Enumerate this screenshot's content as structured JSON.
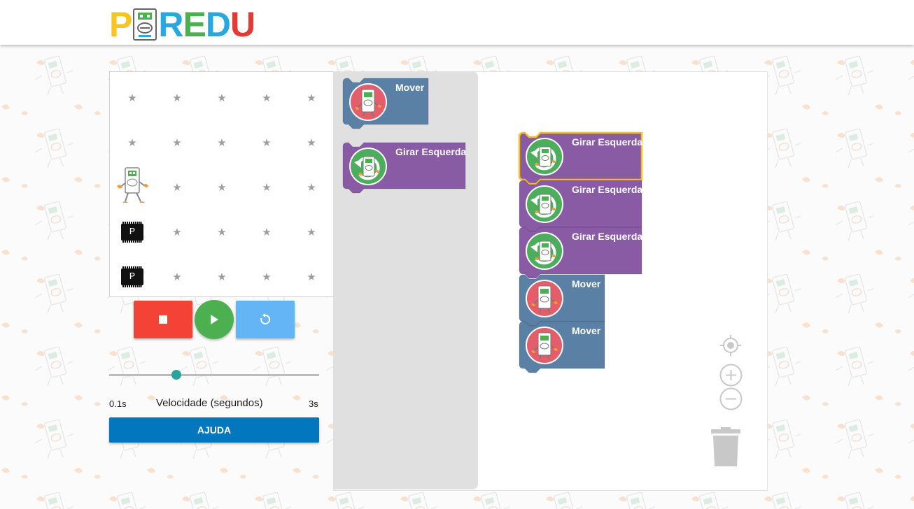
{
  "app": {
    "logo_letters": [
      {
        "char": "P",
        "color": "#f7c51e"
      },
      {
        "char": "R",
        "color": "#4caf50"
      },
      {
        "char": "E",
        "color": "#e53935"
      },
      {
        "char": "D",
        "color": "#29a8e0"
      },
      {
        "char": "U",
        "color": "#e53935"
      }
    ],
    "logo_robot_icon": "robot-face-icon"
  },
  "stage": {
    "grid": {
      "rows": 5,
      "cols": 5
    },
    "robot": {
      "row": 2,
      "col": 0,
      "icon": "robot-icon"
    },
    "chips": [
      {
        "row": 3,
        "col": 0,
        "label": "P"
      },
      {
        "row": 4,
        "col": 0,
        "label": "P"
      }
    ],
    "star_icon": "star-icon"
  },
  "controls": {
    "stop": {
      "icon": "stop-icon",
      "color": "#f44336"
    },
    "play": {
      "icon": "play-icon",
      "color": "#4caf50"
    },
    "reset": {
      "icon": "reset-icon",
      "color": "#64b5f6"
    },
    "speed": {
      "label": "Velocidade (segundos)",
      "min_label": "0.1s",
      "max_label": "3s",
      "value_fraction": 0.32
    },
    "help_label": "AJUDA"
  },
  "toolbox": {
    "blocks": [
      {
        "label": "Mover",
        "kind": "move",
        "color": "#5b80a5",
        "icon": "move-robot-icon"
      },
      {
        "label": "Girar Esquerda",
        "kind": "turn-left",
        "color": "#8a5ba5",
        "icon": "turn-left-robot-icon"
      }
    ]
  },
  "program": {
    "blocks": [
      {
        "label": "Girar Esquerda",
        "kind": "turn-left",
        "color": "#8a5ba5",
        "selected": true
      },
      {
        "label": "Girar Esquerda",
        "kind": "turn-left",
        "color": "#8a5ba5",
        "selected": false
      },
      {
        "label": "Girar Esquerda",
        "kind": "turn-left",
        "color": "#8a5ba5",
        "selected": false
      },
      {
        "label": "Mover",
        "kind": "move",
        "color": "#5b80a5",
        "selected": false
      },
      {
        "label": "Mover",
        "kind": "move",
        "color": "#5b80a5",
        "selected": false
      }
    ],
    "selected_outline_color": "#f9c10b"
  },
  "workspace_controls": {
    "center_icon": "center-target-icon",
    "zoom_in_icon": "zoom-in-icon",
    "zoom_out_icon": "zoom-out-icon",
    "trash_icon": "trash-icon"
  }
}
